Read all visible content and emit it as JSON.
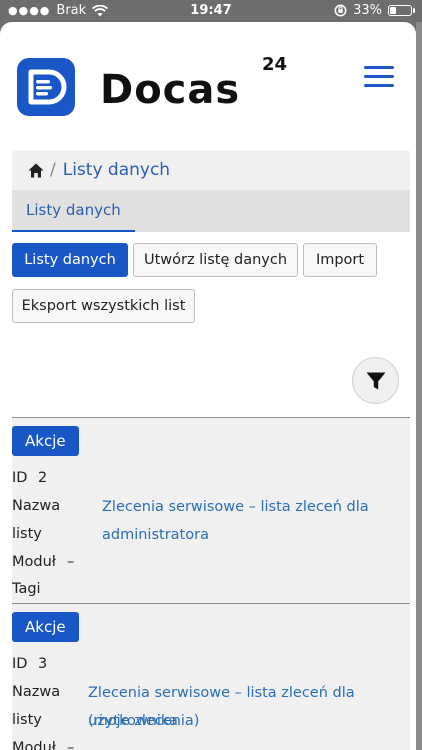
{
  "status_bar": {
    "carrier": "Brak",
    "time": "19:47",
    "battery": "33%",
    "battery_level": 0.33
  },
  "header": {
    "logo_text": "Docas",
    "logo_superscript": "24",
    "menu_icon": "hamburger-icon"
  },
  "breadcrumb": {
    "home_icon": "home-icon",
    "separator": "/",
    "current": "Listy danych"
  },
  "tabs": [
    {
      "label": "Listy danych",
      "active": true
    }
  ],
  "buttons": {
    "listy_danych": "Listy danych",
    "create": "Utwórz listę danych",
    "import": "Import",
    "export_all": "Eksport wszystkich list"
  },
  "filter_icon": "filter-icon",
  "records": [
    {
      "actions_label": "Akcje",
      "id_label": "ID",
      "id_value": "2",
      "name_label_1": "Nazwa",
      "name_label_2": "listy",
      "name_line_1": "Zlecenia serwisowe – lista zleceń dla",
      "name_line_2": "administratora",
      "module_label": "Moduł",
      "module_value": "–",
      "tags_label": "Tagi"
    },
    {
      "actions_label": "Akcje",
      "id_label": "ID",
      "id_value": "3",
      "name_label_1": "Nazwa",
      "name_label_2": "listy",
      "name_line_1": "Zlecenia serwisowe – lista zleceń dla użytkownika",
      "name_line_2": "(moje zlecenia)",
      "module_label": "Moduł",
      "module_value": "–"
    }
  ],
  "colors": {
    "primary": "#1957c7",
    "link": "#2a6fb3",
    "panel": "#f0f0f0"
  }
}
